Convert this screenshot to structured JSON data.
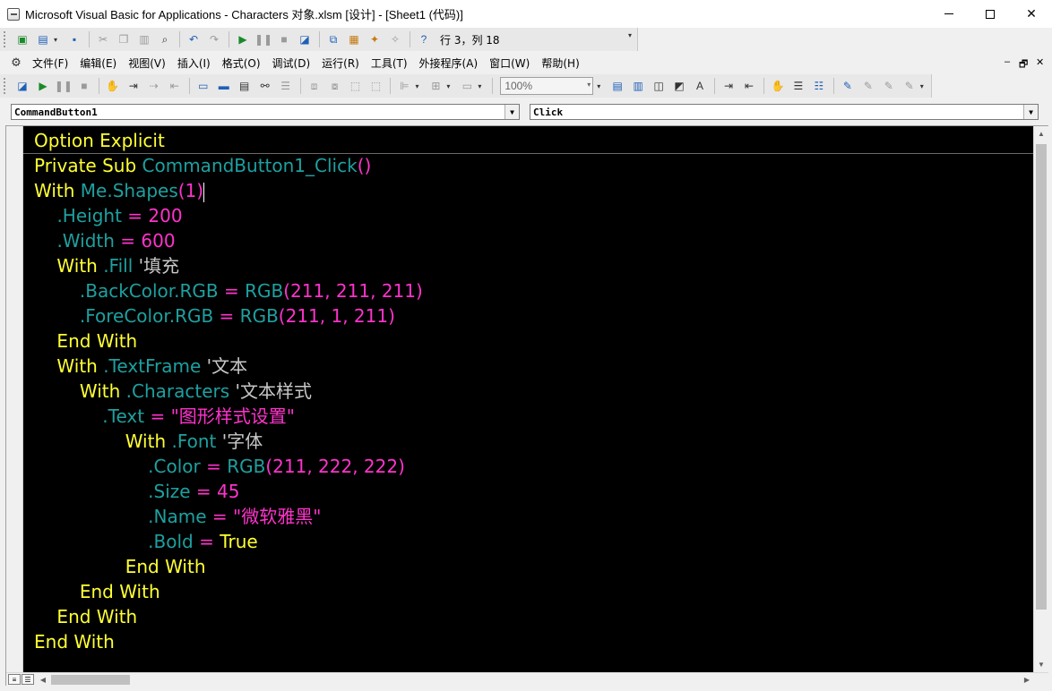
{
  "window": {
    "title": "Microsoft Visual Basic for Applications - Characters 对象.xlsm [设计] - [Sheet1 (代码)]",
    "controls": {
      "minimize_icon": "minimize-icon",
      "maximize_icon": "maximize-icon",
      "close_icon": "close-icon",
      "close_glyph": "✕"
    }
  },
  "toolbar_standard": {
    "cursor_position": "行 3，列 18"
  },
  "menu": {
    "items": [
      "文件(F)",
      "编辑(E)",
      "视图(V)",
      "插入(I)",
      "格式(O)",
      "调试(D)",
      "运行(R)",
      "工具(T)",
      "外接程序(A)",
      "窗口(W)",
      "帮助(H)"
    ],
    "mdi_minimize": "–",
    "mdi_restore": "🗗",
    "mdi_close": "✕"
  },
  "toolbar_edit": {
    "zoom": "100%"
  },
  "selectors": {
    "object": "CommandButton1",
    "procedure": "Click"
  },
  "code": {
    "colors": {
      "keyword": "#ffff33",
      "identifier": "#1ea0a0",
      "number": "#ff33cc",
      "comment": "#c8c8c8",
      "background": "#000000"
    },
    "lines": [
      {
        "segments": [
          {
            "t": "Option Explicit",
            "c": "kw"
          }
        ]
      },
      {
        "segments": [
          {
            "t": "Private Sub ",
            "c": "kw"
          },
          {
            "t": "CommandButton1_Click",
            "c": "id"
          },
          {
            "t": "()",
            "c": "nm"
          }
        ]
      },
      {
        "segments": [
          {
            "t": "With ",
            "c": "kw"
          },
          {
            "t": "Me.Shapes",
            "c": "id"
          },
          {
            "t": "(1)",
            "c": "nm"
          }
        ],
        "caret": true
      },
      {
        "segments": [
          {
            "t": "    ",
            "c": "kw"
          },
          {
            "t": ".Height",
            "c": "id"
          },
          {
            "t": " = 200",
            "c": "nm"
          }
        ]
      },
      {
        "segments": [
          {
            "t": "    ",
            "c": "kw"
          },
          {
            "t": ".Width",
            "c": "id"
          },
          {
            "t": " = 600",
            "c": "nm"
          }
        ]
      },
      {
        "segments": [
          {
            "t": "    With ",
            "c": "kw"
          },
          {
            "t": ".Fill",
            "c": "id"
          },
          {
            "t": " '填充",
            "c": "cm"
          }
        ]
      },
      {
        "segments": [
          {
            "t": "        ",
            "c": "kw"
          },
          {
            "t": ".BackColor.RGB",
            "c": "id"
          },
          {
            "t": " = ",
            "c": "nm"
          },
          {
            "t": "RGB",
            "c": "id"
          },
          {
            "t": "(211, 211, 211)",
            "c": "nm"
          }
        ]
      },
      {
        "segments": [
          {
            "t": "        ",
            "c": "kw"
          },
          {
            "t": ".ForeColor.RGB",
            "c": "id"
          },
          {
            "t": " = ",
            "c": "nm"
          },
          {
            "t": "RGB",
            "c": "id"
          },
          {
            "t": "(211, 1, 211)",
            "c": "nm"
          }
        ]
      },
      {
        "segments": [
          {
            "t": "    End With",
            "c": "kw"
          }
        ]
      },
      {
        "segments": [
          {
            "t": "    With ",
            "c": "kw"
          },
          {
            "t": ".TextFrame",
            "c": "id"
          },
          {
            "t": " '文本",
            "c": "cm"
          }
        ]
      },
      {
        "segments": [
          {
            "t": "        With ",
            "c": "kw"
          },
          {
            "t": ".Characters",
            "c": "id"
          },
          {
            "t": " '文本样式",
            "c": "cm"
          }
        ]
      },
      {
        "segments": [
          {
            "t": "            ",
            "c": "kw"
          },
          {
            "t": ".Text",
            "c": "id"
          },
          {
            "t": " = \"图形样式设置\"",
            "c": "nm"
          }
        ]
      },
      {
        "segments": [
          {
            "t": "                With ",
            "c": "kw"
          },
          {
            "t": ".Font",
            "c": "id"
          },
          {
            "t": " '字体",
            "c": "cm"
          }
        ]
      },
      {
        "segments": [
          {
            "t": "                    ",
            "c": "kw"
          },
          {
            "t": ".Color",
            "c": "id"
          },
          {
            "t": " = ",
            "c": "nm"
          },
          {
            "t": "RGB",
            "c": "id"
          },
          {
            "t": "(211, 222, 222)",
            "c": "nm"
          }
        ]
      },
      {
        "segments": [
          {
            "t": "                    ",
            "c": "kw"
          },
          {
            "t": ".Size",
            "c": "id"
          },
          {
            "t": " = 45",
            "c": "nm"
          }
        ]
      },
      {
        "segments": [
          {
            "t": "                    ",
            "c": "kw"
          },
          {
            "t": ".Name",
            "c": "id"
          },
          {
            "t": " = \"微软雅黑\"",
            "c": "nm"
          }
        ]
      },
      {
        "segments": [
          {
            "t": "                    ",
            "c": "kw"
          },
          {
            "t": ".Bold",
            "c": "id"
          },
          {
            "t": " = ",
            "c": "nm"
          },
          {
            "t": "True",
            "c": "kw"
          }
        ]
      },
      {
        "segments": [
          {
            "t": "                End With",
            "c": "kw"
          }
        ]
      },
      {
        "segments": [
          {
            "t": "        End With",
            "c": "kw"
          }
        ]
      },
      {
        "segments": [
          {
            "t": "    End With",
            "c": "kw"
          }
        ]
      },
      {
        "segments": [
          {
            "t": "End With",
            "c": "kw"
          }
        ]
      }
    ]
  }
}
